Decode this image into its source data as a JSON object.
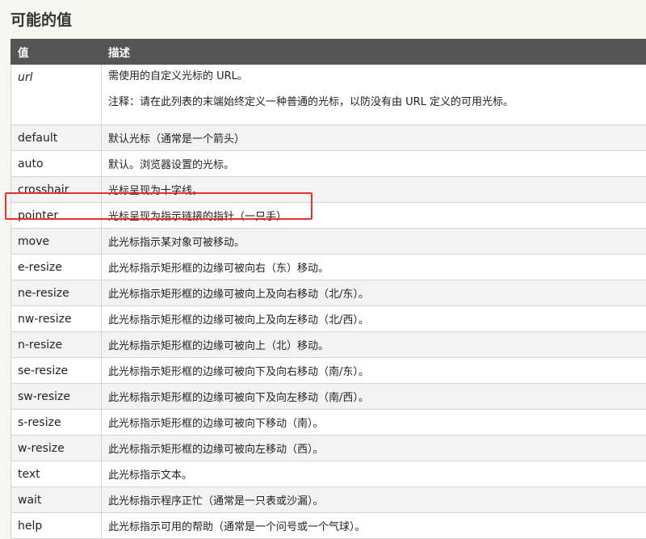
{
  "section": {
    "title": "可能的值"
  },
  "table": {
    "headers": [
      "值",
      "描述"
    ],
    "rows": [
      {
        "value": "url",
        "italic": true,
        "desc": "需使用的自定义光标的 URL。",
        "desc2": "注释：请在此列表的末端始终定义一种普通的光标，以防没有由 URL 定义的可用光标。"
      },
      {
        "value": "default",
        "desc": "默认光标（通常是一个箭头）"
      },
      {
        "value": "auto",
        "desc": "默认。浏览器设置的光标。"
      },
      {
        "value": "crosshair",
        "desc": "光标呈现为十字线。"
      },
      {
        "value": "pointer",
        "desc": "光标呈现为指示链接的指针（一只手）"
      },
      {
        "value": "move",
        "desc": "此光标指示某对象可被移动。"
      },
      {
        "value": "e-resize",
        "desc": "此光标指示矩形框的边缘可被向右（东）移动。"
      },
      {
        "value": "ne-resize",
        "desc": "此光标指示矩形框的边缘可被向上及向右移动（北/东）。"
      },
      {
        "value": "nw-resize",
        "desc": "此光标指示矩形框的边缘可被向上及向左移动（北/西）。"
      },
      {
        "value": "n-resize",
        "desc": "此光标指示矩形框的边缘可被向上（北）移动。"
      },
      {
        "value": "se-resize",
        "desc": "此光标指示矩形框的边缘可被向下及向右移动（南/东）。"
      },
      {
        "value": "sw-resize",
        "desc": "此光标指示矩形框的边缘可被向下及向左移动（南/西）。"
      },
      {
        "value": "s-resize",
        "desc": "此光标指示矩形框的边缘可被向下移动（南）。"
      },
      {
        "value": "w-resize",
        "desc": "此光标指示矩形框的边缘可被向左移动（西）。"
      },
      {
        "value": "text",
        "desc": "此光标指示文本。"
      },
      {
        "value": "wait",
        "desc": "此光标指示程序正忙（通常是一只表或沙漏）。"
      },
      {
        "value": "help",
        "desc": "此光标指示可用的帮助（通常是一个问号或一个气球）。"
      }
    ]
  },
  "highlight": {
    "row_value": "pointer",
    "color": "#e8302f"
  }
}
